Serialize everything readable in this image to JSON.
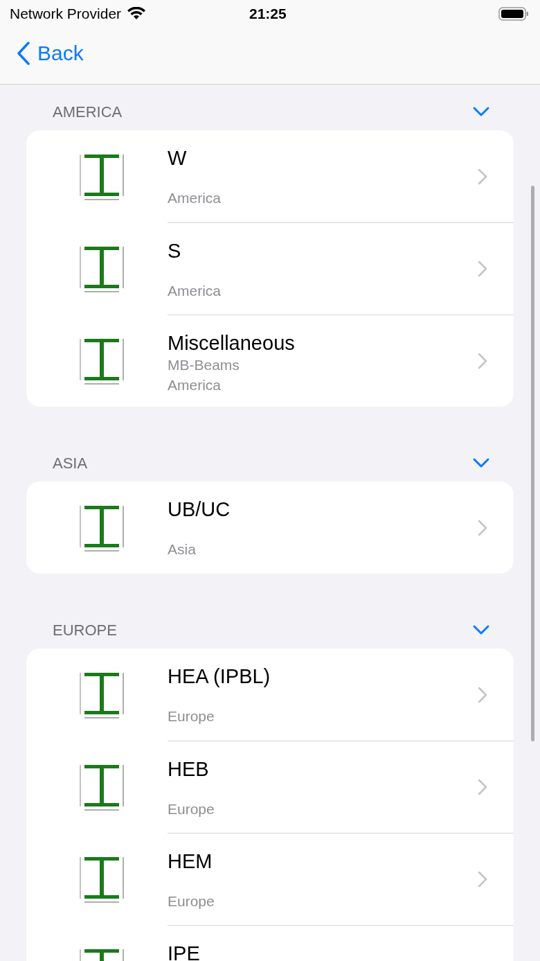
{
  "status_bar": {
    "carrier": "Network Provider",
    "time": "21:25"
  },
  "nav": {
    "back": "Back"
  },
  "sections": [
    {
      "title": "AMERICA",
      "expanded": true,
      "items": [
        {
          "title": "W",
          "subtitles": [
            "America"
          ]
        },
        {
          "title": "S",
          "subtitles": [
            "America"
          ]
        },
        {
          "title": "Miscellaneous",
          "subtitles": [
            "MB-Beams",
            "America"
          ]
        }
      ]
    },
    {
      "title": "ASIA",
      "expanded": true,
      "items": [
        {
          "title": "UB/UC",
          "subtitles": [
            "Asia"
          ]
        }
      ]
    },
    {
      "title": "EUROPE",
      "expanded": true,
      "items": [
        {
          "title": "HEA (IPBL)",
          "subtitles": [
            "Europe"
          ]
        },
        {
          "title": "HEB",
          "subtitles": [
            "Europe"
          ]
        },
        {
          "title": "HEM",
          "subtitles": [
            "Europe"
          ]
        },
        {
          "title": "IPE"
        }
      ]
    }
  ]
}
